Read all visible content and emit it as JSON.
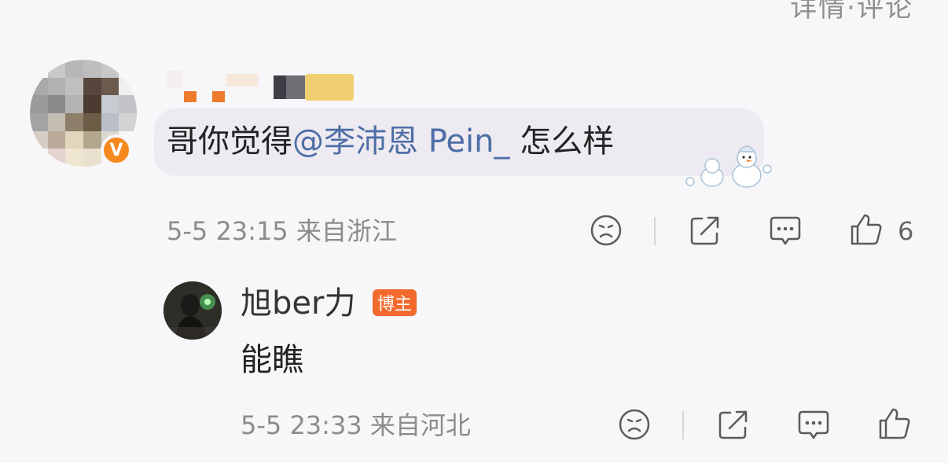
{
  "top_partial_text": "详情·评论",
  "comment": {
    "author_badge": "V",
    "text_before": "哥你觉得",
    "mention": "@李沛恩 Pein_",
    "text_after": " 怎么样",
    "meta": "5-5 23:15  来自浙江",
    "like_count": "6",
    "icons": [
      "dislike-icon",
      "share-icon",
      "comment-icon",
      "like-icon"
    ]
  },
  "reply": {
    "author": "旭ber力",
    "badge": "博主",
    "text": "能瞧",
    "meta": "5-5 23:33  来自河北",
    "icons": [
      "dislike-icon",
      "share-icon",
      "comment-icon",
      "like-icon"
    ]
  },
  "colors": {
    "background": "#f7f6f9",
    "mention": "#4d6ea6",
    "verified_badge": "#f5891d",
    "host_badge": "#f26a2e"
  }
}
